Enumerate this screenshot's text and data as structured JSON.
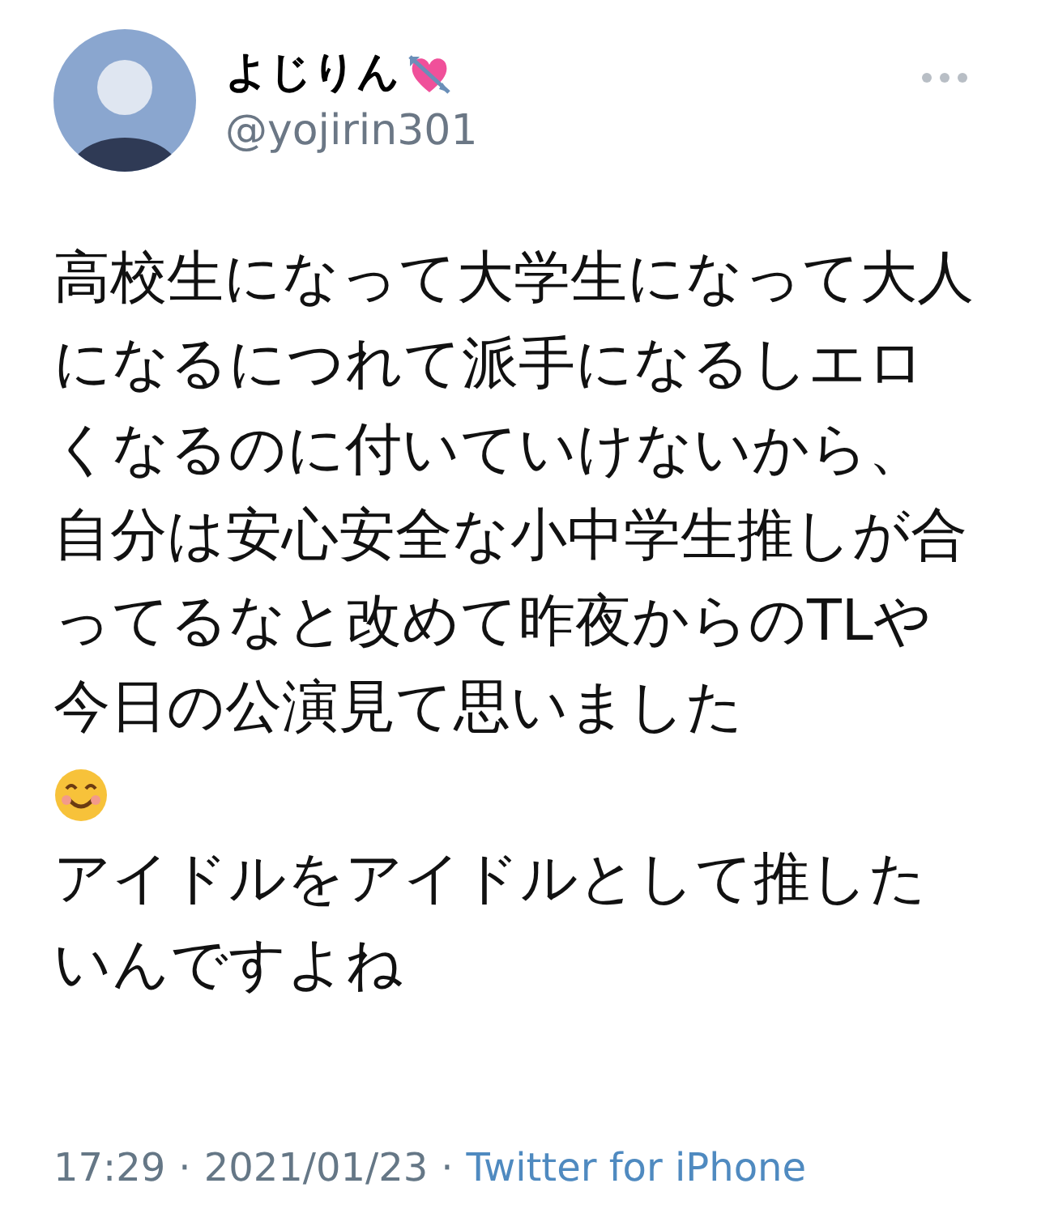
{
  "author": {
    "name": "よじりん",
    "handle": "@yojirin301"
  },
  "body": [
    "高校生になって大学生になって大人になるにつれて派手になるしエロくなるのに付いていけないから、自分は安心安全な小中学生推しが合ってるなと改めて昨夜からのTLや今日の公演見て思いました",
    "アイドルをアイドルとして推したいんですよね"
  ],
  "meta": {
    "time": "17:29",
    "date": "2021/01/23",
    "separator": "·",
    "source": "Twitter for iPhone"
  }
}
